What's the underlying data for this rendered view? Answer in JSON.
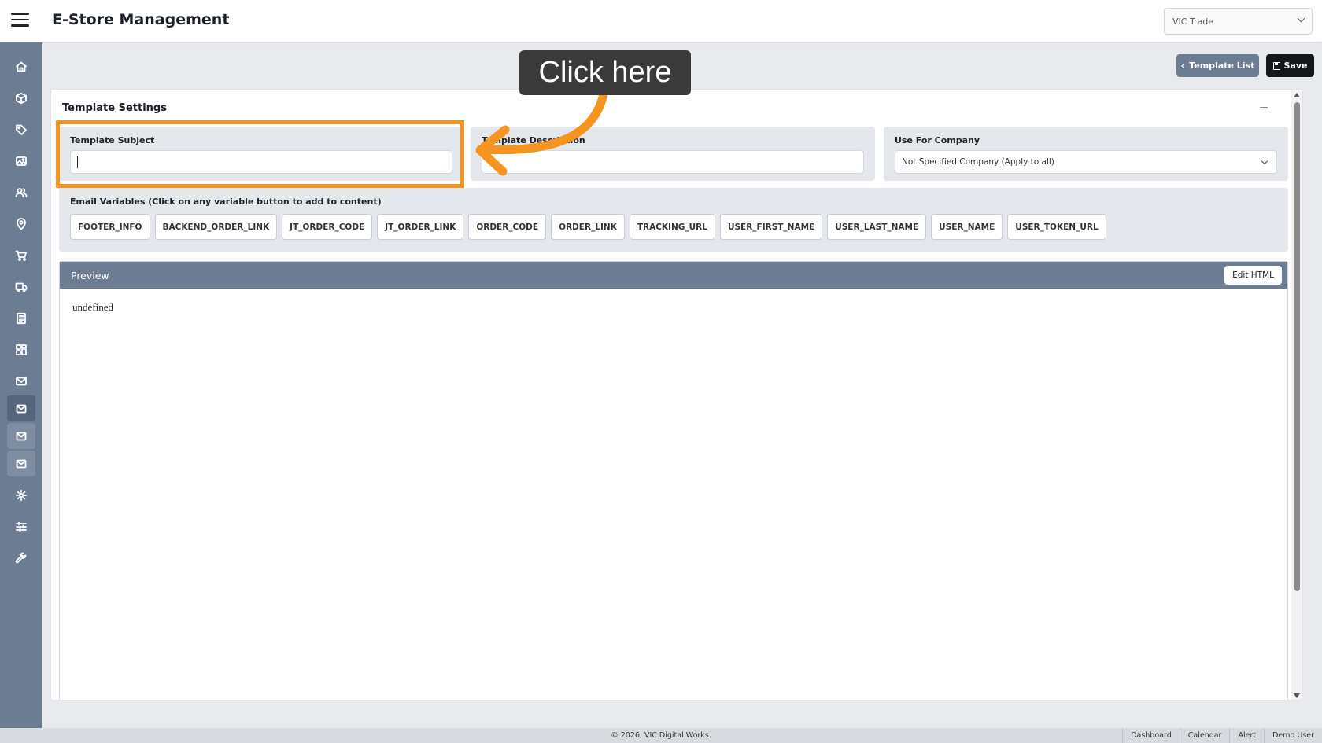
{
  "header": {
    "title": "E-Store Management",
    "company_select": "VIC Trade"
  },
  "sidebar": {
    "icons": [
      "home-icon",
      "box-icon",
      "tag-icon",
      "images-icon",
      "users-icon",
      "location-icon",
      "cart-icon",
      "truck-icon",
      "document-icon",
      "grid-icon",
      "mail-icon",
      "mail-icon",
      "mail-icon",
      "mail-icon",
      "gear-icon",
      "sliders-icon",
      "wrench-icon"
    ]
  },
  "toolbar": {
    "template_list_label": "Template List",
    "save_label": "Save"
  },
  "card": {
    "title": "Template Settings"
  },
  "form": {
    "subject_label": "Template Subject",
    "subject_value": "",
    "description_label": "Template Description",
    "description_value": "",
    "company_label": "Use For Company",
    "company_value": "Not Specified Company (Apply to all)"
  },
  "variables": {
    "label": "Email Variables (Click on any variable button to add to content)",
    "items": [
      "FOOTER_INFO",
      "BACKEND_ORDER_LINK",
      "JT_ORDER_CODE",
      "JT_ORDER_LINK",
      "ORDER_CODE",
      "ORDER_LINK",
      "TRACKING_URL",
      "USER_FIRST_NAME",
      "USER_LAST_NAME",
      "USER_NAME",
      "USER_TOKEN_URL"
    ]
  },
  "preview": {
    "title": "Preview",
    "edit_label": "Edit HTML",
    "content": "undefined"
  },
  "annotation": {
    "tooltip": "Click here",
    "color": "#f5941e"
  },
  "footer": {
    "copyright": "© 2026, VIC Digital Works.",
    "links": [
      "Dashboard",
      "Calendar",
      "Alert",
      "Demo User"
    ]
  },
  "colors": {
    "sidebar": "#6c7c93",
    "accent_dark": "#14171c"
  }
}
